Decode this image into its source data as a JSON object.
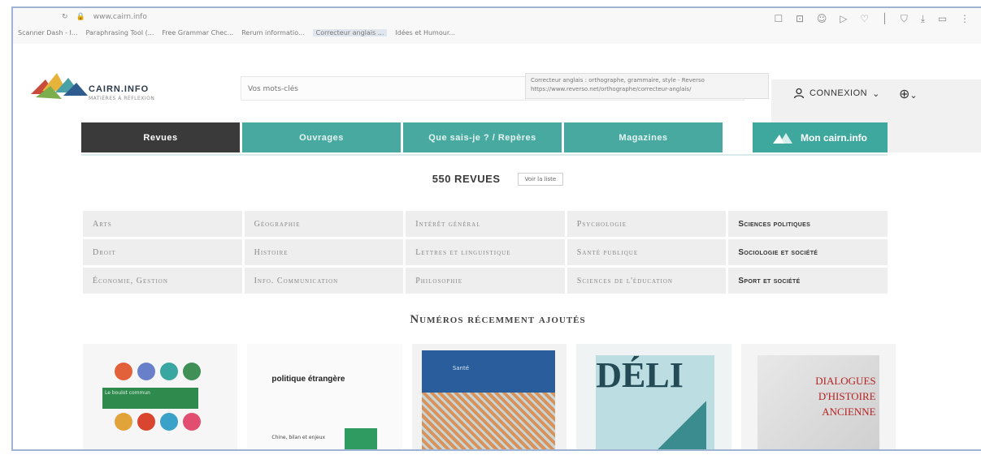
{
  "browser": {
    "url": "www.cairn.info",
    "bookmarks": [
      "Scanner Dash - I...",
      "Paraphrasing Tool (...",
      "Free Grammar Chec...",
      "Rerum informatio...",
      "Correcteur anglais ...",
      "Idées et Humour..."
    ],
    "toolbar_icons": "☐ ⊡ ☺ ▷ ♡ │ ⛉ ⤓ ▭ ⋮"
  },
  "header": {
    "logo_name": "CAIRN.INFO",
    "logo_tagline": "MATIÈRES À RÉFLEXION",
    "search_placeholder": "Vos mots-clés",
    "tooltip_line1": "Correcteur anglais : orthographe, grammaire, style - Reverso",
    "tooltip_line2": "https://www.reverso.net/orthographe/correcteur-anglais/",
    "login_label": "CONNEXION",
    "login_icon": "user-icon",
    "globe_icon": "globe-icon"
  },
  "nav": {
    "tabs": [
      "Revues",
      "Ouvrages",
      "Que sais-je ? / Repères",
      "Magazines"
    ],
    "active_tab": 0,
    "mycairn_label": "Mon cairn.info"
  },
  "revues": {
    "count_label": "550 REVUES",
    "list_button": "Voir la liste",
    "disciplines": [
      "Arts",
      "Géographie",
      "Intérêt général",
      "Psychologie",
      "Sciences politiques",
      "Droit",
      "Histoire",
      "Lettres et linguistique",
      "Santé publique",
      "Sociologie et société",
      "Économie, Gestion",
      "Info. Communication",
      "Philosophie",
      "Sciences de l'éducation",
      "Sport et société"
    ]
  },
  "recent": {
    "title": "Numéros récemment ajoutés",
    "covers": [
      {
        "label": "Le boulot commun"
      },
      {
        "label": "politique étrangère",
        "sub": "Chine, bilan et enjeux"
      },
      {
        "label": "Santé"
      },
      {
        "label": "DÉLI"
      },
      {
        "label": "DIALOGUES D'HISTOIRE ANCIENNE"
      }
    ]
  },
  "colors": {
    "teal": "#47a9a0",
    "dark_tab": "#3a3a3a",
    "cell_bg": "#eeeeee"
  }
}
